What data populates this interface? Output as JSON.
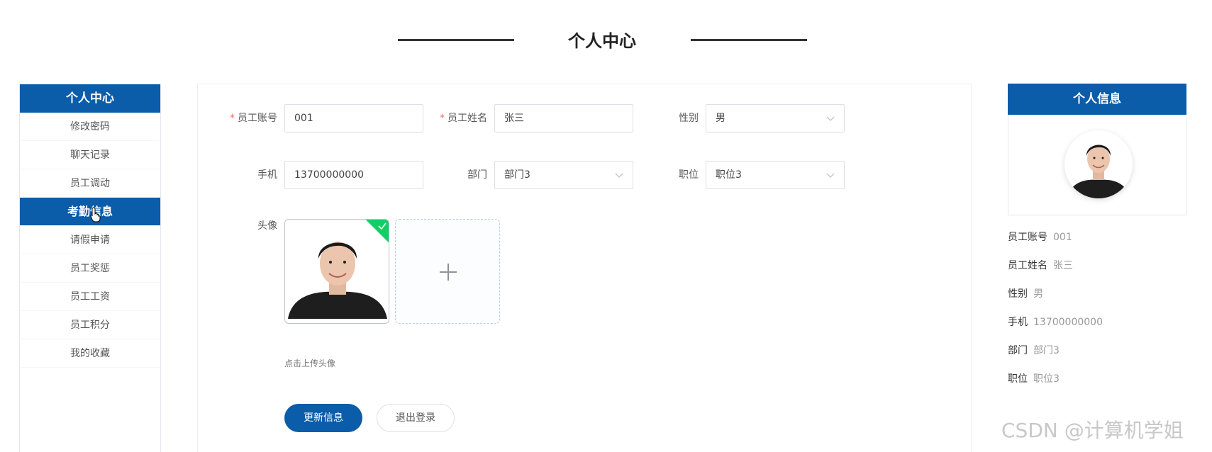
{
  "page_title": "个人中心",
  "sidebar": {
    "header": "个人中心",
    "items": [
      {
        "label": "修改密码",
        "active": false
      },
      {
        "label": "聊天记录",
        "active": false
      },
      {
        "label": "员工调动",
        "active": false
      },
      {
        "label": "考勤信息",
        "active": true
      },
      {
        "label": "请假申请",
        "active": false
      },
      {
        "label": "员工奖惩",
        "active": false
      },
      {
        "label": "员工工资",
        "active": false
      },
      {
        "label": "员工积分",
        "active": false
      },
      {
        "label": "我的收藏",
        "active": false
      }
    ]
  },
  "form": {
    "account_label": "员工账号",
    "account_value": "001",
    "name_label": "员工姓名",
    "name_value": "张三",
    "gender_label": "性别",
    "gender_value": "男",
    "phone_label": "手机",
    "phone_value": "13700000000",
    "dept_label": "部门",
    "dept_value": "部门3",
    "position_label": "职位",
    "position_value": "职位3",
    "avatar_label": "头像",
    "upload_tip": "点击上传头像",
    "update_button": "更新信息",
    "logout_button": "退出登录"
  },
  "info": {
    "header": "个人信息",
    "rows": [
      {
        "label": "员工账号",
        "value": "001"
      },
      {
        "label": "员工姓名",
        "value": "张三"
      },
      {
        "label": "性别",
        "value": "男"
      },
      {
        "label": "手机",
        "value": "13700000000"
      },
      {
        "label": "部门",
        "value": "部门3"
      },
      {
        "label": "职位",
        "value": "职位3"
      }
    ]
  },
  "watermark": "CSDN @计算机学姐",
  "colors": {
    "primary": "#0b5ca9",
    "required": "#f56c6c",
    "success": "#13ce66"
  }
}
